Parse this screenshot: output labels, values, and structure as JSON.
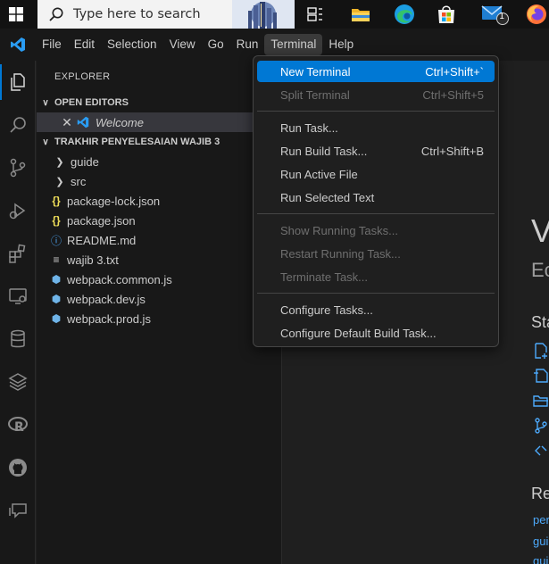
{
  "taskbar": {
    "search_placeholder": "Type here to search",
    "mail_badge": "1"
  },
  "menubar": {
    "items": [
      "File",
      "Edit",
      "Selection",
      "View",
      "Go",
      "Run",
      "Terminal",
      "Help"
    ],
    "active": "Terminal"
  },
  "explorer": {
    "title": "EXPLORER",
    "open_editors_header": "OPEN EDITORS",
    "open_editor_tab": "Welcome",
    "project_header": "TRAKHIR PENYELESAIAN WAJIB 3",
    "tree": [
      {
        "label": "guide",
        "kind": "folder"
      },
      {
        "label": "src",
        "kind": "folder"
      },
      {
        "label": "package-lock.json",
        "kind": "json"
      },
      {
        "label": "package.json",
        "kind": "json"
      },
      {
        "label": "README.md",
        "kind": "info"
      },
      {
        "label": "wajib 3.txt",
        "kind": "text"
      },
      {
        "label": "webpack.common.js",
        "kind": "webpack"
      },
      {
        "label": "webpack.dev.js",
        "kind": "webpack"
      },
      {
        "label": "webpack.prod.js",
        "kind": "webpack"
      }
    ]
  },
  "terminal_menu": {
    "items": [
      {
        "label": "New Terminal",
        "shortcut": "Ctrl+Shift+`",
        "state": "highlighted"
      },
      {
        "label": "Split Terminal",
        "shortcut": "Ctrl+Shift+5",
        "state": "disabled"
      },
      {
        "label": "Run Task...",
        "shortcut": "",
        "state": "enabled"
      },
      {
        "label": "Run Build Task...",
        "shortcut": "Ctrl+Shift+B",
        "state": "enabled"
      },
      {
        "label": "Run Active File",
        "shortcut": "",
        "state": "enabled"
      },
      {
        "label": "Run Selected Text",
        "shortcut": "",
        "state": "enabled"
      },
      {
        "label": "Show Running Tasks...",
        "shortcut": "",
        "state": "disabled"
      },
      {
        "label": "Restart Running Task...",
        "shortcut": "",
        "state": "disabled"
      },
      {
        "label": "Terminate Task...",
        "shortcut": "",
        "state": "disabled"
      },
      {
        "label": "Configure Tasks...",
        "shortcut": "",
        "state": "enabled"
      },
      {
        "label": "Configure Default Build Task...",
        "shortcut": "",
        "state": "enabled"
      }
    ]
  },
  "welcome": {
    "title_fragment": "V",
    "subtitle_fragment": "Ec",
    "start_heading_fragment": "Sta",
    "recent_heading_fragment": "Re",
    "recent_links": [
      "per",
      "gui",
      "gui"
    ]
  },
  "colors": {
    "accent": "#0078d4",
    "link": "#4daafc",
    "menu_bg": "#1f1f1f"
  }
}
